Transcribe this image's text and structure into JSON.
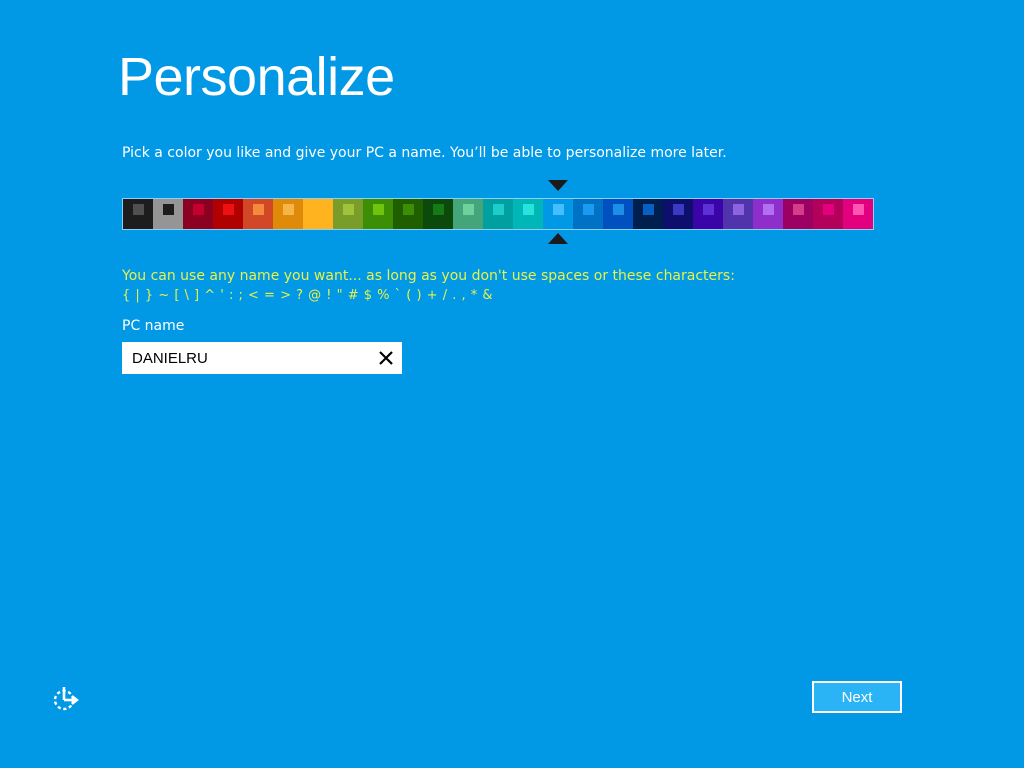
{
  "theme": {
    "background": "#0199e6",
    "accent_text": "#e7f24a",
    "button_fill": "#2ab3f5",
    "marker_color": "#1a1a1a"
  },
  "page": {
    "title": "Personalize",
    "subtitle": "Pick a color you like and give your PC a name. You’ll be able to personalize more later."
  },
  "palette": {
    "selected_index": 14,
    "swatches": [
      {
        "bg": "#1d1d1d",
        "chip": "#505050"
      },
      {
        "bg": "#959595",
        "chip": "#1d1d1d"
      },
      {
        "bg": "#8c0021",
        "chip": "#c3002f"
      },
      {
        "bg": "#b00000",
        "chip": "#ee1111"
      },
      {
        "bg": "#d24726",
        "chip": "#f38a3c"
      },
      {
        "bg": "#e08a0a",
        "chip": "#f7b547"
      },
      {
        "bg": "#ffb41f",
        "chip": "#ffb41f"
      },
      {
        "bg": "#7a9d2a",
        "chip": "#a0c33b"
      },
      {
        "bg": "#3c8e05",
        "chip": "#71c40e"
      },
      {
        "bg": "#1f5f00",
        "chip": "#3c8e05"
      },
      {
        "bg": "#0c4a0b",
        "chip": "#167b16"
      },
      {
        "bg": "#44a57a",
        "chip": "#6fd19c"
      },
      {
        "bg": "#00a0a0",
        "chip": "#1ecccc"
      },
      {
        "bg": "#00b6b6",
        "chip": "#29e3dd"
      },
      {
        "bg": "#0199e6",
        "chip": "#45bdff"
      },
      {
        "bg": "#0072c6",
        "chip": "#1a9bf0"
      },
      {
        "bg": "#0050c0",
        "chip": "#1d8ee8"
      },
      {
        "bg": "#001e4e",
        "chip": "#0761c2"
      },
      {
        "bg": "#0e0f6c",
        "chip": "#3a3bc2"
      },
      {
        "bg": "#3a04a9",
        "chip": "#5e30d8"
      },
      {
        "bg": "#5133ab",
        "chip": "#8d63e0"
      },
      {
        "bg": "#8e2fcc",
        "chip": "#b26ff0"
      },
      {
        "bg": "#9b0062",
        "chip": "#d43c8c"
      },
      {
        "bg": "#b2005b",
        "chip": "#e3007f"
      },
      {
        "bg": "#e3007f",
        "chip": "#ff55b3"
      }
    ]
  },
  "rules": {
    "line1": "You can use any name you want... as long as you don't use spaces or these characters:",
    "line2": "{ | } ~ [ \\ ] ^ ' : ; < = > ? @ ! \" # $ % ` ( ) + / . , * &"
  },
  "name_field": {
    "label": "PC name",
    "value": "DANIELRU",
    "clear_icon": "close-icon"
  },
  "footer": {
    "ease_icon": "ease-of-access-icon",
    "next_label": "Next"
  }
}
